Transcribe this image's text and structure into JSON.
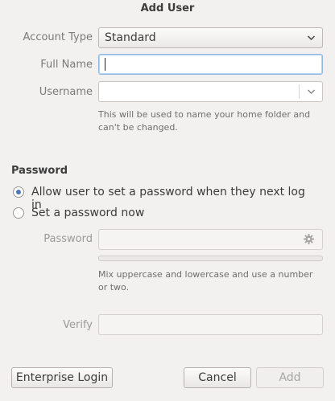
{
  "window": {
    "title": "Add User"
  },
  "form": {
    "account_type_label": "Account Type",
    "account_type_value": "Standard",
    "full_name_label": "Full Name",
    "full_name_value": "",
    "username_label": "Username",
    "username_value": "",
    "username_hint": "This will be used to name your home folder and can't be changed."
  },
  "password": {
    "section_title": "Password",
    "option_next_login": "Allow user to set a password when they next log in",
    "option_set_now": "Set a password now",
    "selected_option": "next_login",
    "password_label": "Password",
    "password_hint": "Mix uppercase and lowercase and use a number or two.",
    "verify_label": "Verify",
    "strength_level": 0
  },
  "buttons": {
    "enterprise_login": "Enterprise Login",
    "cancel": "Cancel",
    "add": "Add"
  },
  "icons": {
    "dropdown": "chevron-down-icon",
    "password_generate": "gear-icon"
  }
}
